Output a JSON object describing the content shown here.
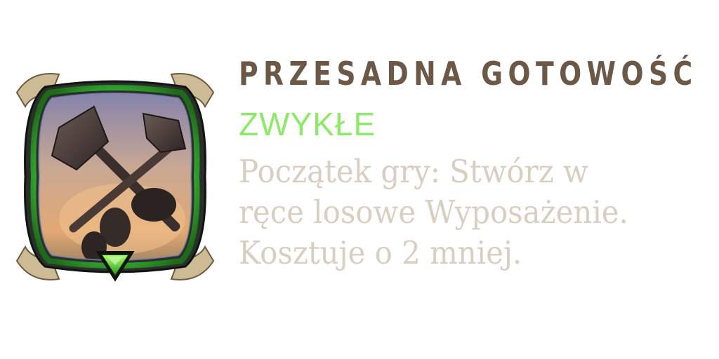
{
  "card": {
    "title": "PRZESADNA GOTOWOŚĆ",
    "rarity": "ZWYKŁE",
    "description_lines": [
      "Początek gry: Stwórz w",
      "ręce losowe Wyposażenie.",
      "Kosztuje o 2 mniej."
    ],
    "icon": "crossed-axes-icon",
    "rarity_gem": "down-arrow-gem-icon",
    "colors": {
      "title": "#6b5847",
      "rarity": "#8ee86a",
      "description": "#d8cec2",
      "frame_glow": "#4fd64a"
    }
  }
}
